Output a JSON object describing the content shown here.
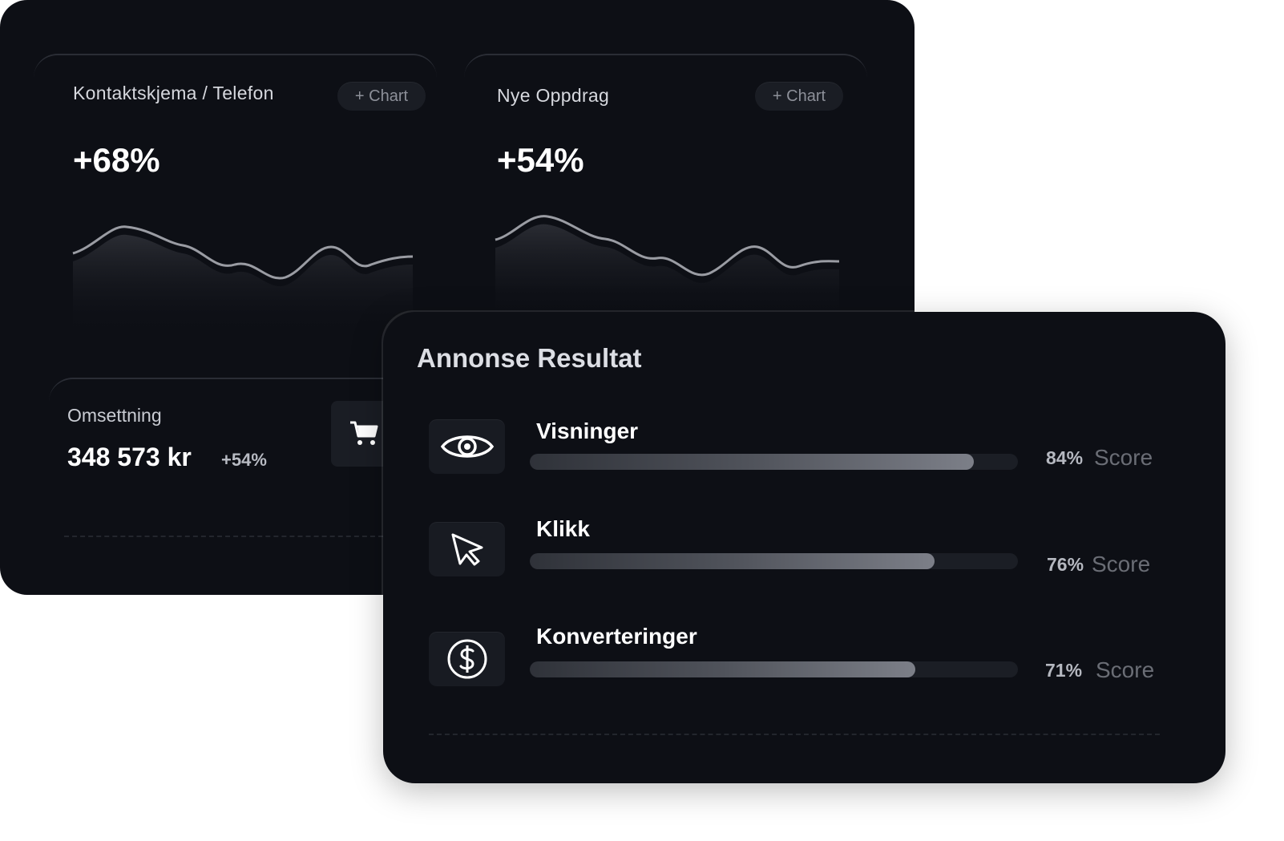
{
  "cards": [
    {
      "title": "Kontaktskjema / Telefon",
      "button": "+ Chart",
      "value": "+68%"
    },
    {
      "title": "Nye Oppdrag",
      "button": "+ Chart",
      "value": "+54%"
    }
  ],
  "revenue": {
    "label": "Omsettning",
    "value": "348 573 kr",
    "delta": "+54%",
    "icon": "cart-icon"
  },
  "ads": {
    "title": "Annonse Resultat",
    "metrics": [
      {
        "label": "Visninger",
        "percent": "84%",
        "score_label": "Score",
        "fill": 0.91,
        "icon": "eye-icon"
      },
      {
        "label": "Klikk",
        "percent": "76%",
        "score_label": "Score",
        "fill": 0.83,
        "icon": "cursor-icon"
      },
      {
        "label": "Konverteringer",
        "percent": "71%",
        "score_label": "Score",
        "fill": 0.79,
        "icon": "dollar-icon"
      }
    ]
  },
  "colors": {
    "panel": "#0d0f15",
    "chip": "#1a1d24",
    "line": "#9a9ca3",
    "background": "#ffffff"
  }
}
